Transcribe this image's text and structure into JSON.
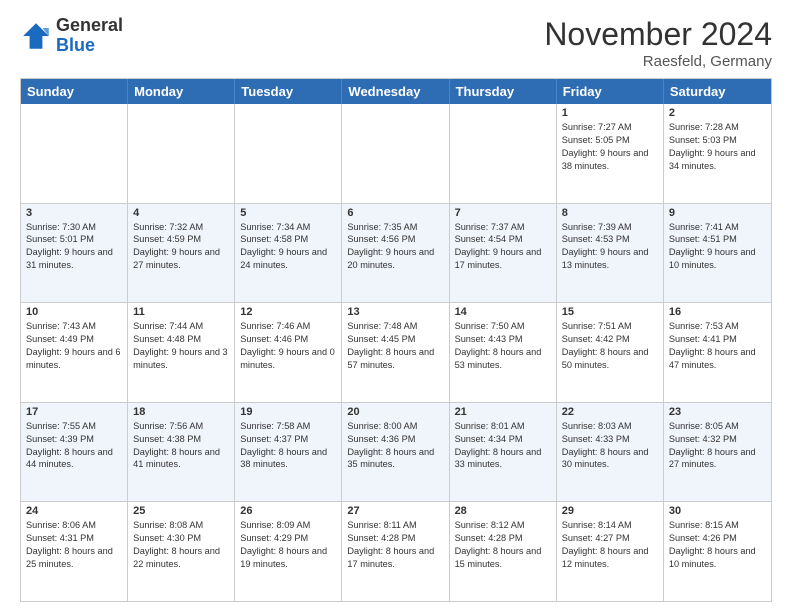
{
  "header": {
    "logo_general": "General",
    "logo_blue": "Blue",
    "month_title": "November 2024",
    "location": "Raesfeld, Germany"
  },
  "weekdays": [
    "Sunday",
    "Monday",
    "Tuesday",
    "Wednesday",
    "Thursday",
    "Friday",
    "Saturday"
  ],
  "rows": [
    [
      {
        "day": "",
        "text": ""
      },
      {
        "day": "",
        "text": ""
      },
      {
        "day": "",
        "text": ""
      },
      {
        "day": "",
        "text": ""
      },
      {
        "day": "",
        "text": ""
      },
      {
        "day": "1",
        "text": "Sunrise: 7:27 AM\nSunset: 5:05 PM\nDaylight: 9 hours and 38 minutes."
      },
      {
        "day": "2",
        "text": "Sunrise: 7:28 AM\nSunset: 5:03 PM\nDaylight: 9 hours and 34 minutes."
      }
    ],
    [
      {
        "day": "3",
        "text": "Sunrise: 7:30 AM\nSunset: 5:01 PM\nDaylight: 9 hours and 31 minutes."
      },
      {
        "day": "4",
        "text": "Sunrise: 7:32 AM\nSunset: 4:59 PM\nDaylight: 9 hours and 27 minutes."
      },
      {
        "day": "5",
        "text": "Sunrise: 7:34 AM\nSunset: 4:58 PM\nDaylight: 9 hours and 24 minutes."
      },
      {
        "day": "6",
        "text": "Sunrise: 7:35 AM\nSunset: 4:56 PM\nDaylight: 9 hours and 20 minutes."
      },
      {
        "day": "7",
        "text": "Sunrise: 7:37 AM\nSunset: 4:54 PM\nDaylight: 9 hours and 17 minutes."
      },
      {
        "day": "8",
        "text": "Sunrise: 7:39 AM\nSunset: 4:53 PM\nDaylight: 9 hours and 13 minutes."
      },
      {
        "day": "9",
        "text": "Sunrise: 7:41 AM\nSunset: 4:51 PM\nDaylight: 9 hours and 10 minutes."
      }
    ],
    [
      {
        "day": "10",
        "text": "Sunrise: 7:43 AM\nSunset: 4:49 PM\nDaylight: 9 hours and 6 minutes."
      },
      {
        "day": "11",
        "text": "Sunrise: 7:44 AM\nSunset: 4:48 PM\nDaylight: 9 hours and 3 minutes."
      },
      {
        "day": "12",
        "text": "Sunrise: 7:46 AM\nSunset: 4:46 PM\nDaylight: 9 hours and 0 minutes."
      },
      {
        "day": "13",
        "text": "Sunrise: 7:48 AM\nSunset: 4:45 PM\nDaylight: 8 hours and 57 minutes."
      },
      {
        "day": "14",
        "text": "Sunrise: 7:50 AM\nSunset: 4:43 PM\nDaylight: 8 hours and 53 minutes."
      },
      {
        "day": "15",
        "text": "Sunrise: 7:51 AM\nSunset: 4:42 PM\nDaylight: 8 hours and 50 minutes."
      },
      {
        "day": "16",
        "text": "Sunrise: 7:53 AM\nSunset: 4:41 PM\nDaylight: 8 hours and 47 minutes."
      }
    ],
    [
      {
        "day": "17",
        "text": "Sunrise: 7:55 AM\nSunset: 4:39 PM\nDaylight: 8 hours and 44 minutes."
      },
      {
        "day": "18",
        "text": "Sunrise: 7:56 AM\nSunset: 4:38 PM\nDaylight: 8 hours and 41 minutes."
      },
      {
        "day": "19",
        "text": "Sunrise: 7:58 AM\nSunset: 4:37 PM\nDaylight: 8 hours and 38 minutes."
      },
      {
        "day": "20",
        "text": "Sunrise: 8:00 AM\nSunset: 4:36 PM\nDaylight: 8 hours and 35 minutes."
      },
      {
        "day": "21",
        "text": "Sunrise: 8:01 AM\nSunset: 4:34 PM\nDaylight: 8 hours and 33 minutes."
      },
      {
        "day": "22",
        "text": "Sunrise: 8:03 AM\nSunset: 4:33 PM\nDaylight: 8 hours and 30 minutes."
      },
      {
        "day": "23",
        "text": "Sunrise: 8:05 AM\nSunset: 4:32 PM\nDaylight: 8 hours and 27 minutes."
      }
    ],
    [
      {
        "day": "24",
        "text": "Sunrise: 8:06 AM\nSunset: 4:31 PM\nDaylight: 8 hours and 25 minutes."
      },
      {
        "day": "25",
        "text": "Sunrise: 8:08 AM\nSunset: 4:30 PM\nDaylight: 8 hours and 22 minutes."
      },
      {
        "day": "26",
        "text": "Sunrise: 8:09 AM\nSunset: 4:29 PM\nDaylight: 8 hours and 19 minutes."
      },
      {
        "day": "27",
        "text": "Sunrise: 8:11 AM\nSunset: 4:28 PM\nDaylight: 8 hours and 17 minutes."
      },
      {
        "day": "28",
        "text": "Sunrise: 8:12 AM\nSunset: 4:28 PM\nDaylight: 8 hours and 15 minutes."
      },
      {
        "day": "29",
        "text": "Sunrise: 8:14 AM\nSunset: 4:27 PM\nDaylight: 8 hours and 12 minutes."
      },
      {
        "day": "30",
        "text": "Sunrise: 8:15 AM\nSunset: 4:26 PM\nDaylight: 8 hours and 10 minutes."
      }
    ]
  ]
}
